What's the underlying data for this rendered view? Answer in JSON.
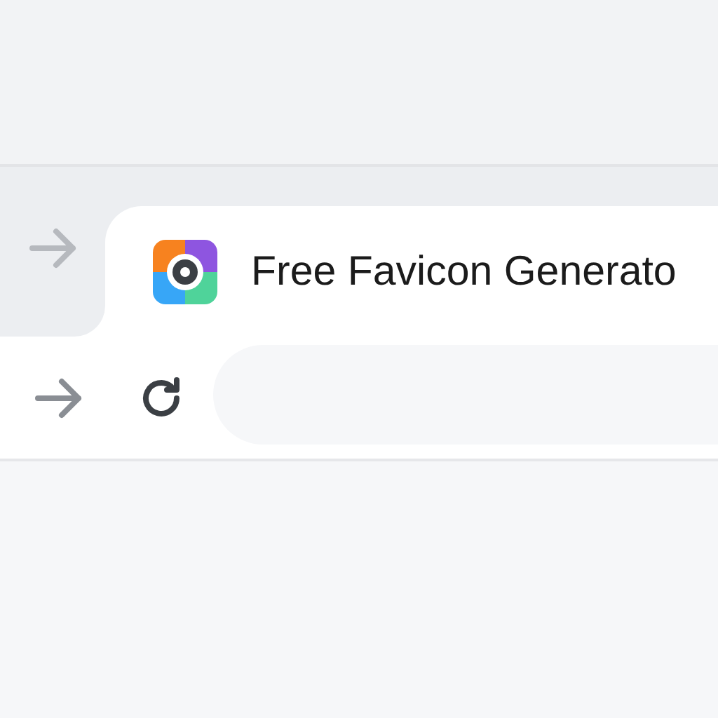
{
  "tabs": [
    {
      "title": "Free Favicon Generato",
      "selected": true
    }
  ]
}
